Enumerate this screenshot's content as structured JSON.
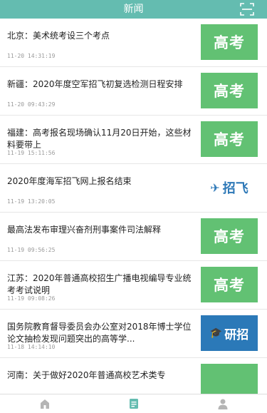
{
  "header": {
    "title": "新闻"
  },
  "news": [
    {
      "title": "北京：美术统考设三个考点",
      "time": "11-20 14:31:19",
      "thumb_type": "gaokao",
      "thumb_label": "高考"
    },
    {
      "title": "新疆：2020年度空军招飞初复选检测日程安排",
      "time": "11-20 09:43:29",
      "thumb_type": "gaokao",
      "thumb_label": "高考"
    },
    {
      "title": "福建：高考报名现场确认11月20日开始，这些材料要带上",
      "time": "11-19 15:11:56",
      "thumb_type": "gaokao",
      "thumb_label": "高考"
    },
    {
      "title": "2020年度海军招飞网上报名结束",
      "time": "11-19 13:20:05",
      "thumb_type": "zhaofei",
      "thumb_label": "招飞"
    },
    {
      "title": "最高法发布审理兴奋剂刑事案件司法解释",
      "time": "11-19 09:56:25",
      "thumb_type": "gaokao",
      "thumb_label": "高考"
    },
    {
      "title": "江苏：2020年普通高校招生广播电视编导专业统考考试说明",
      "time": "11-19 09:08:26",
      "thumb_type": "gaokao",
      "thumb_label": "高考"
    },
    {
      "title": "国务院教育督导委员会办公室对2018年博士学位论文抽检发现问题突出的高等学...",
      "time": "11-18 14:14:10",
      "thumb_type": "yanzhao",
      "thumb_label": "研招"
    },
    {
      "title": "河南：关于做好2020年普通高校艺术类专",
      "time": "",
      "thumb_type": "gaokao",
      "thumb_label": ""
    }
  ],
  "tabbar": {
    "tabs": [
      {
        "icon": "home-icon",
        "active": false
      },
      {
        "icon": "news-icon",
        "active": true
      },
      {
        "icon": "user-icon",
        "active": false
      }
    ],
    "colors": {
      "active": "#64bcb0",
      "inactive": "#b5b5b5"
    }
  },
  "colors": {
    "header_bg": "#64bcb0",
    "gaokao_bg": "#62c173",
    "yanzhao_bg": "#2b79b8",
    "zhaofei_text": "#2d78b7"
  }
}
